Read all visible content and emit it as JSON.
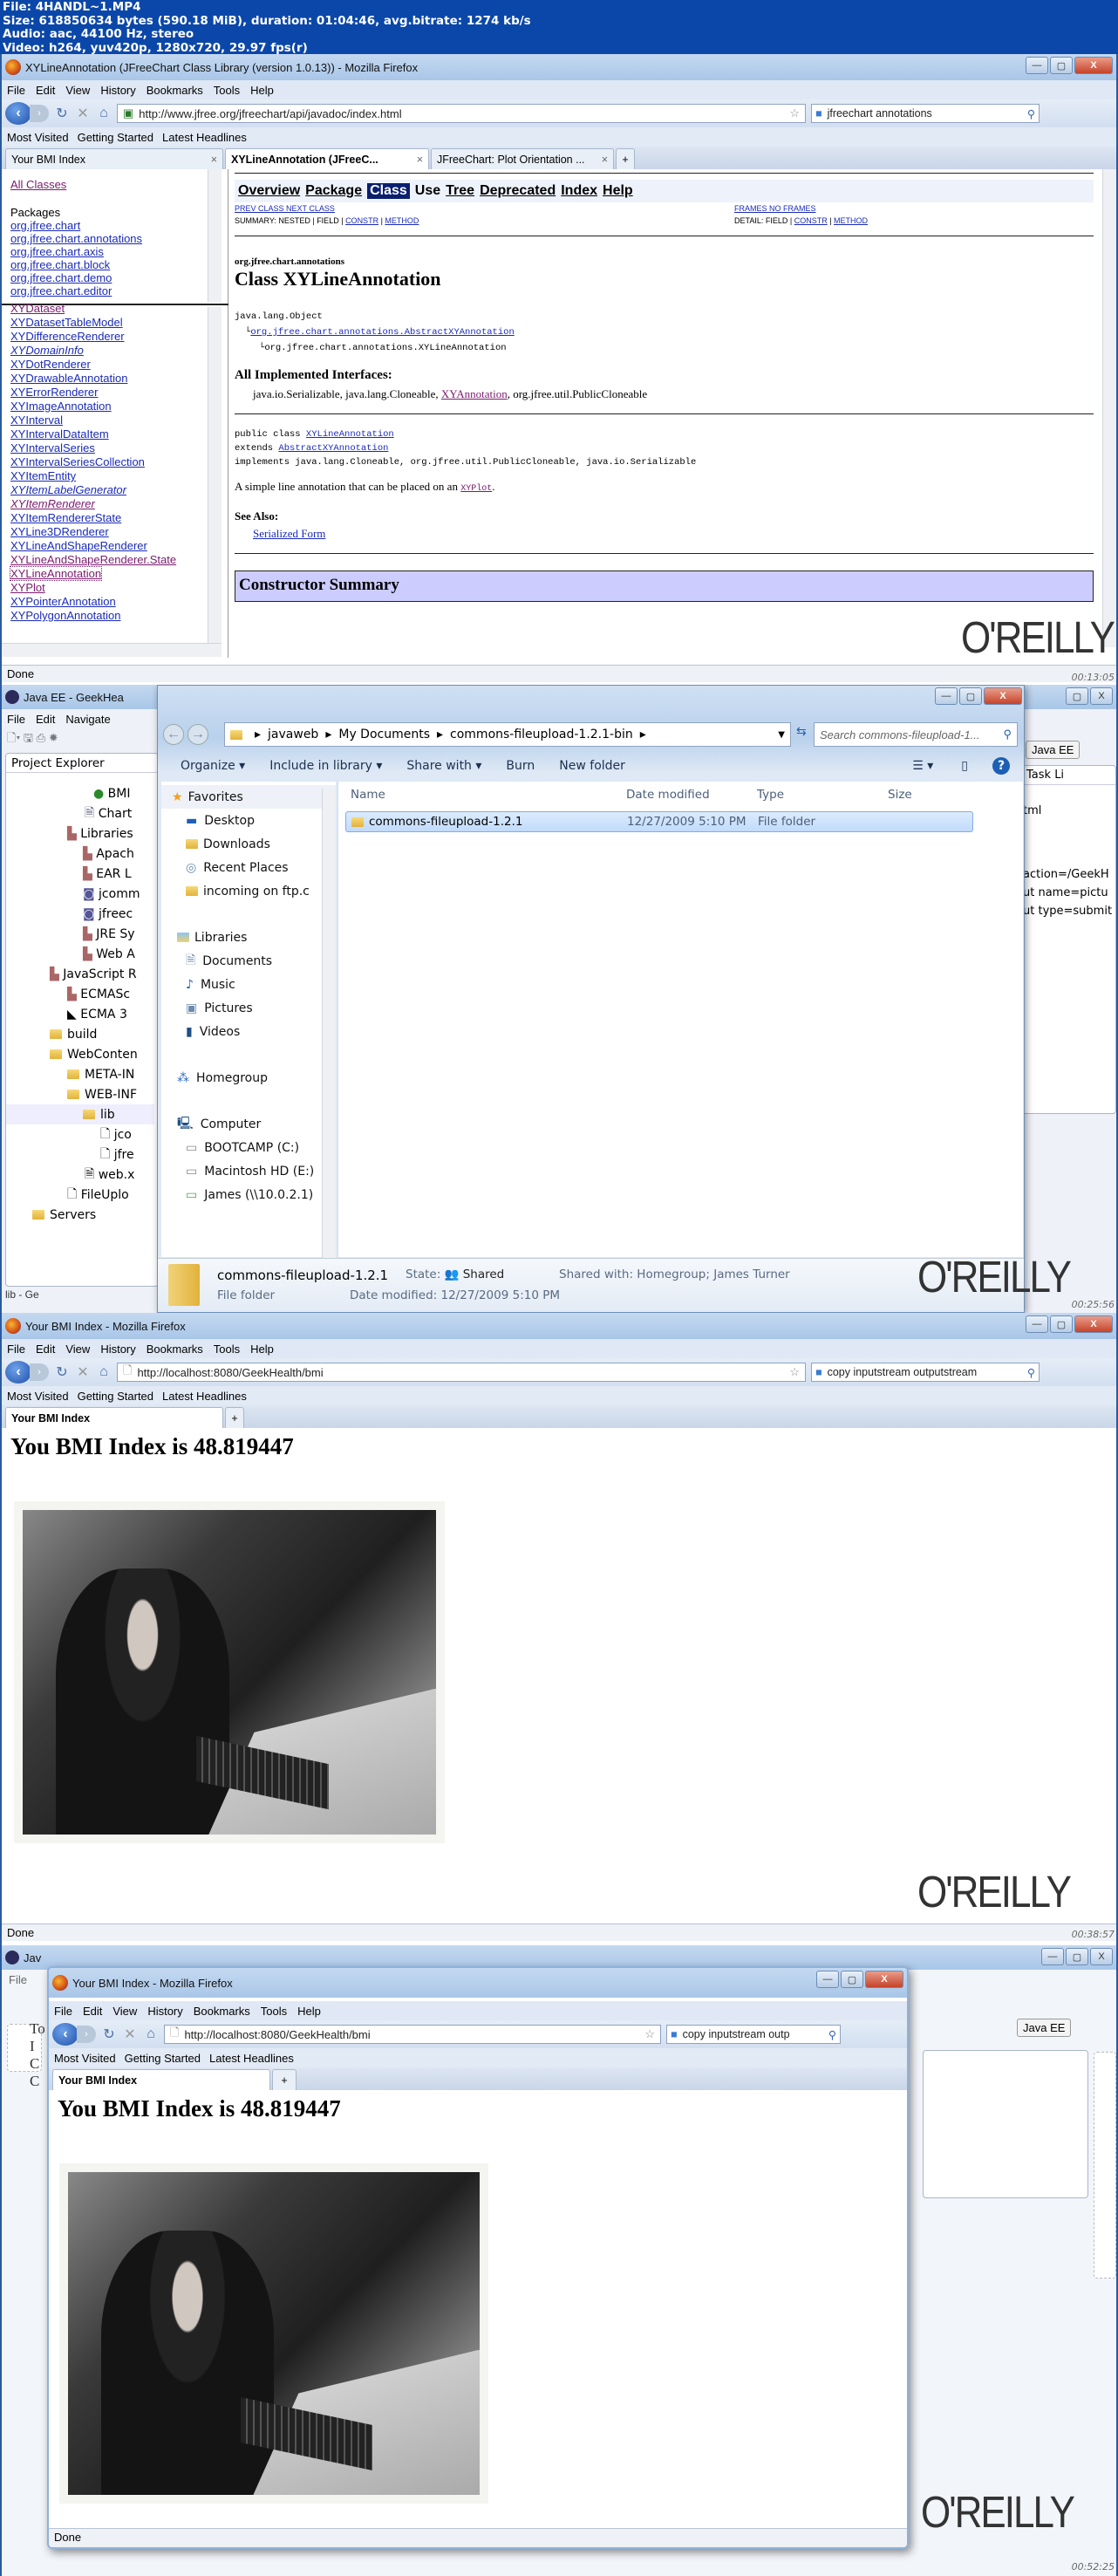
{
  "header": {
    "file": "File: 4HANDL~1.MP4",
    "size": "Size: 618850634 bytes (590.18 MiB), duration: 01:04:46, avg.bitrate: 1274 kb/s",
    "audio": "Audio: aac, 44100 Hz, stereo",
    "video": "Video: h264, yuv420p, 1280x720, 29.97 fps(r)"
  },
  "watermark": "O'REILLY",
  "menu": {
    "file": "File",
    "edit": "Edit",
    "view": "View",
    "history": "History",
    "bookmarks": "Bookmarks",
    "tools": "Tools",
    "help": "Help"
  },
  "bookmarks": {
    "most_visited": "Most Visited",
    "getting_started": "Getting Started",
    "latest_headlines": "Latest Headlines"
  },
  "frame1": {
    "window_title": "XYLineAnnotation (JFreeChart Class Library (version 1.0.13)) - Mozilla Firefox",
    "url": "http://www.jfree.org/jfreechart/api/javadoc/index.html",
    "search": "jfreechart annotations",
    "tabs": [
      {
        "label": "Your BMI Index"
      },
      {
        "label": "XYLineAnnotation (JFreeC..."
      },
      {
        "label": "JFreeChart: Plot Orientation ..."
      }
    ],
    "sidebar": {
      "all_classes": "All Classes",
      "packages_heading": "Packages",
      "packages": [
        "org.jfree.chart",
        "org.jfree.chart.annotations",
        "org.jfree.chart.axis",
        "org.jfree.chart.block",
        "org.jfree.chart.demo",
        "org.jfree.chart.editor"
      ],
      "classes": [
        "XYDataset",
        "XYDatasetTableModel",
        "XYDifferenceRenderer",
        "XYDomainInfo",
        "XYDotRenderer",
        "XYDrawableAnnotation",
        "XYErrorRenderer",
        "XYImageAnnotation",
        "XYInterval",
        "XYIntervalDataItem",
        "XYIntervalSeries",
        "XYIntervalSeriesCollection",
        "XYItemEntity",
        "XYItemLabelGenerator",
        "XYItemRenderer",
        "XYItemRendererState",
        "XYLine3DRenderer",
        "XYLineAndShapeRenderer",
        "XYLineAndShapeRenderer.State",
        "XYLineAnnotation",
        "XYPlot",
        "XYPointerAnnotation",
        "XYPolygonAnnotation"
      ]
    },
    "doc": {
      "nav": [
        "Overview",
        "Package",
        "Class",
        "Use",
        "Tree",
        "Deprecated",
        "Index",
        "Help"
      ],
      "prev_next": "PREV CLASS   NEXT CLASS",
      "frames": "FRAMES   NO FRAMES",
      "summary_label": "SUMMARY: NESTED | FIELD |",
      "detail_label": "DETAIL: FIELD |",
      "constr": "CONSTR",
      "method": "METHOD",
      "package": "org.jfree.chart.annotations",
      "class_title": "Class XYLineAnnotation",
      "hierarchy": [
        "java.lang.Object",
        "org.jfree.chart.annotations.AbstractXYAnnotation",
        "org.jfree.chart.annotations.XYLineAnnotation"
      ],
      "interfaces_heading": "All Implemented Interfaces:",
      "interfaces_pre": "java.io.Serializable, java.lang.Cloneable, ",
      "interfaces_link": "XYAnnotation",
      "interfaces_post": ", org.jfree.util.PublicCloneable",
      "decl_1a": "public class ",
      "decl_1b": "XYLineAnnotation",
      "decl_2a": "extends ",
      "decl_2b": "AbstractXYAnnotation",
      "decl_3": "implements java.lang.Cloneable, org.jfree.util.PublicCloneable, java.io.Serializable",
      "desc_pre": "A simple line annotation that can be placed on an ",
      "desc_link": "XYPlot",
      "desc_post": ".",
      "see_also": "See Also:",
      "serialized_form": "Serialized Form",
      "constructor_summary": "Constructor Summary"
    },
    "status": "Done",
    "timecode": "00:13:05"
  },
  "frame2": {
    "eclipse_title": "Java EE - GeekHea",
    "eclipse_menu": [
      "File",
      "Edit",
      "Navigate"
    ],
    "project_explorer": "Project Explorer",
    "tree": [
      "BMI",
      "Chart",
      "Libraries",
      "Apach",
      "EAR L",
      "jcomm",
      "jfreec",
      "JRE Sy",
      "Web A",
      "JavaScript R",
      "ECMASc",
      "ECMA 3",
      "build",
      "WebConten",
      "META-IN",
      "WEB-INF",
      "lib",
      "jco",
      "jfre",
      "web.x",
      "FileUplo",
      "Servers"
    ],
    "bottom_tab": "lib - Ge",
    "explorer": {
      "breadcrumb": [
        "javaweb",
        "My Documents",
        "commons-fileupload-1.2.1-bin"
      ],
      "search_placeholder": "Search commons-fileupload-1...",
      "toolbar": [
        "Organize",
        "Include in library",
        "Share with",
        "Burn",
        "New folder"
      ],
      "nav": {
        "favorites": "Favorites",
        "desktop": "Desktop",
        "downloads": "Downloads",
        "recent": "Recent Places",
        "incoming": "incoming on ftp.c",
        "libraries": "Libraries",
        "documents": "Documents",
        "music": "Music",
        "pictures": "Pictures",
        "videos": "Videos",
        "homegroup": "Homegroup",
        "computer": "Computer",
        "bootcamp": "BOOTCAMP (C:)",
        "macintosh": "Macintosh HD (E:)",
        "james": "James (\\\\10.0.2.1)"
      },
      "columns": [
        "Name",
        "Date modified",
        "Type",
        "Size"
      ],
      "rows": [
        {
          "name": "commons-fileupload-1.2.1",
          "date": "12/27/2009 5:10 PM",
          "type": "File folder",
          "size": ""
        }
      ],
      "details": {
        "name": "commons-fileupload-1.2.1",
        "kind": "File folder",
        "state_label": "State:",
        "state": "Shared",
        "date_modified": "Date modified: 12/27/2009 5:10 PM",
        "shared_with": "Shared with: Homegroup; James Turner"
      }
    },
    "eclipse_right": {
      "perspective": "Java EE",
      "task_list": "Task Li",
      "lines": [
        "tml",
        "action=/GeekH",
        "ut name=pictu",
        "ut type=submit"
      ]
    },
    "timecode": "00:25:56"
  },
  "frame3": {
    "window_title": "Your BMI Index - Mozilla Firefox",
    "url": "http://localhost:8080/GeekHealth/bmi",
    "search": "copy inputstream outputstream",
    "tab": "Your BMI Index",
    "heading": "You BMI Index is 48.819447",
    "status": "Done",
    "timecode": "00:38:57"
  },
  "frame4": {
    "eclipse_title": "Jav",
    "eclipse_menu": "File",
    "window_title": "Your BMI Index - Mozilla Firefox",
    "url": "http://localhost:8080/GeekHealth/bmi",
    "search": "copy inputstream outp",
    "tab": "Your BMI Index",
    "heading": "You BMI Index is 48.819447",
    "status": "Done",
    "perspective": "Java EE",
    "left_letters": [
      "To",
      "I",
      "C",
      "C"
    ],
    "timecode": "00:52:25"
  }
}
